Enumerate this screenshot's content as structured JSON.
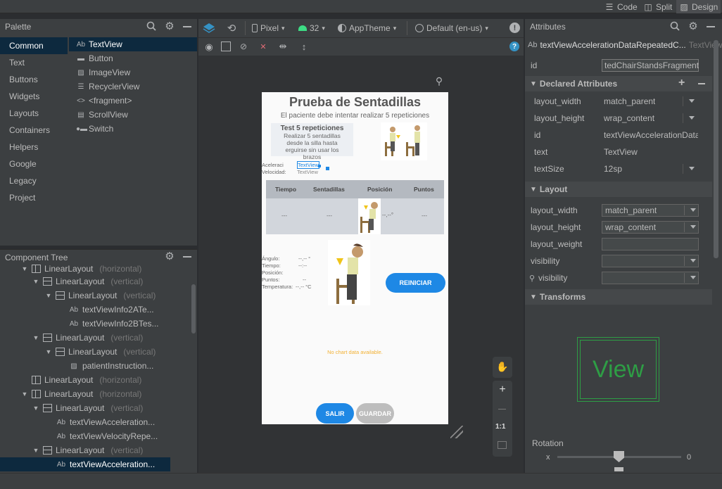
{
  "topbar": {
    "code": "Code",
    "split": "Split",
    "design": "Design"
  },
  "palette": {
    "title": "Palette",
    "categories": [
      "Common",
      "Text",
      "Buttons",
      "Widgets",
      "Layouts",
      "Containers",
      "Helpers",
      "Google",
      "Legacy",
      "Project"
    ],
    "items": [
      {
        "glyph": "Ab",
        "label": "TextView"
      },
      {
        "glyph": "▬",
        "label": "Button"
      },
      {
        "glyph": "▨",
        "label": "ImageView"
      },
      {
        "glyph": "☰",
        "label": "RecyclerView"
      },
      {
        "glyph": "<>",
        "label": "<fragment>"
      },
      {
        "glyph": "▤",
        "label": "ScrollView"
      },
      {
        "glyph": "●▬",
        "label": "Switch"
      }
    ]
  },
  "tree": {
    "title": "Component Tree",
    "rows": [
      {
        "label": "LinearLayout",
        "ori": "(horizontal)"
      },
      {
        "label": "LinearLayout",
        "ori": "(vertical)"
      },
      {
        "label": "LinearLayout",
        "ori": "(vertical)"
      },
      {
        "label": "textViewInfo2ATe...",
        "ori": ""
      },
      {
        "label": "textViewInfo2BTes...",
        "ori": ""
      },
      {
        "label": "LinearLayout",
        "ori": "(vertical)"
      },
      {
        "label": "LinearLayout",
        "ori": "(vertical)"
      },
      {
        "label": "patientInstruction...",
        "ori": ""
      },
      {
        "label": "LinearLayout",
        "ori": "(horizontal)"
      },
      {
        "label": "LinearLayout",
        "ori": "(horizontal)"
      },
      {
        "label": "LinearLayout",
        "ori": "(vertical)"
      },
      {
        "label": "textViewAcceleration...",
        "ori": ""
      },
      {
        "label": "textViewVelocityRepe...",
        "ori": ""
      },
      {
        "label": "LinearLayout",
        "ori": "(vertical)"
      },
      {
        "label": "textViewAcceleration...",
        "ori": ""
      }
    ]
  },
  "design_toolbar": {
    "device": "Pixel",
    "api": "32",
    "theme": "AppTheme",
    "locale": "Default (en-us)"
  },
  "phone": {
    "title": "Prueba de Sentadillas",
    "subtitle": "El paciente debe intentar realizar 5 repeticiones",
    "test_title": "Test 5 repeticiones",
    "test_desc": "Realizar 5 sentadillas desde la silla hasta erguirse sin usar los brazos",
    "accel_label": "Aceleraci",
    "vel_label": "Velocidad:",
    "tv1": "TextView",
    "tv2": "TextView",
    "table_headers": [
      "Tiempo",
      "Sentadillas",
      "Posición",
      "Puntos"
    ],
    "table_values": [
      "---",
      "---",
      "--,--°",
      "---"
    ],
    "info_labels": [
      "Ángulo:",
      "Tiempo:",
      "Posición:",
      "Puntos:",
      "Temperatura:"
    ],
    "info_values": [
      "--,-- °",
      "--:--",
      "",
      "--",
      "--,-- °C"
    ],
    "reiniciar": "REINICIAR",
    "no_chart": "No chart data available.",
    "salir": "SALIR",
    "guardar": "GUARDAR"
  },
  "zoom": {
    "ratio": "1:1"
  },
  "attributes": {
    "title": "Attributes",
    "component_glyph": "Ab",
    "component": "textViewAccelerationDataRepeatedC...",
    "component_type": "TextView",
    "id_label": "id",
    "id_value": "tedChairStandsFragment",
    "declared_title": "Declared Attributes",
    "declared": [
      {
        "name": "layout_width",
        "value": "match_parent"
      },
      {
        "name": "layout_height",
        "value": "wrap_content"
      },
      {
        "name": "id",
        "value": "textViewAccelerationData"
      },
      {
        "name": "text",
        "value": "TextView"
      },
      {
        "name": "textSize",
        "value": "12sp"
      }
    ],
    "layout_title": "Layout",
    "layout": [
      {
        "name": "layout_width",
        "value": "match_parent"
      },
      {
        "name": "layout_height",
        "value": "wrap_content"
      },
      {
        "name": "layout_weight",
        "value": ""
      },
      {
        "name": "visibility",
        "value": ""
      },
      {
        "name": "visibility",
        "value": ""
      }
    ],
    "transforms_title": "Transforms",
    "preview_text": "View",
    "rotation_label": "Rotation",
    "rotation_axis": "x",
    "rotation_value": "0"
  },
  "colors": {
    "accent": "#1e88e5",
    "selection": "#0d293e",
    "chart_note": "#f2b134"
  }
}
